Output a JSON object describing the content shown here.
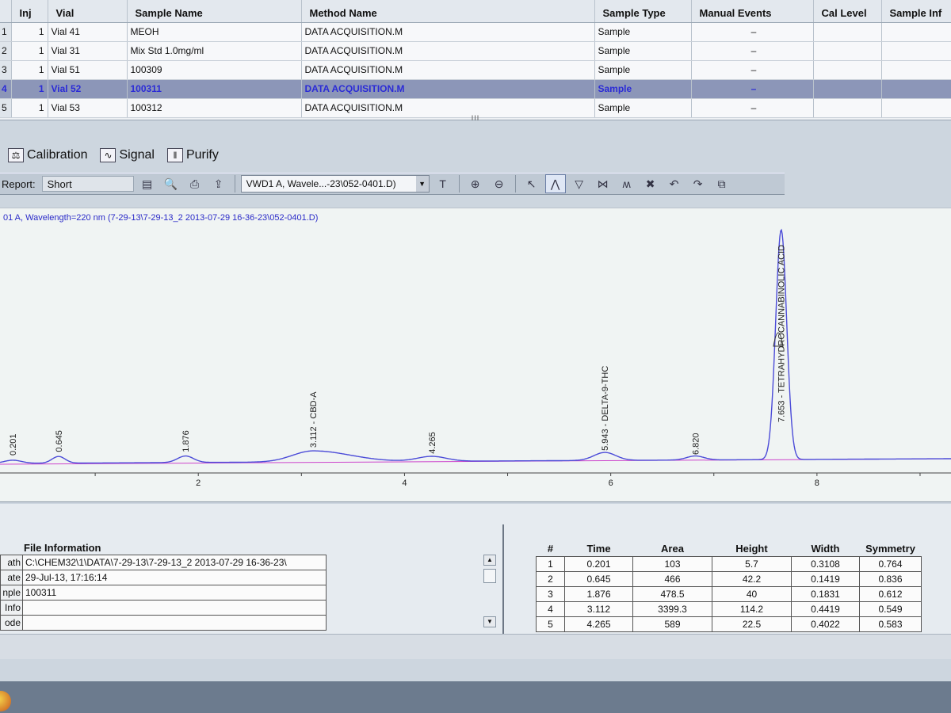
{
  "sequence": {
    "columns": [
      "Inj",
      "Vial",
      "Sample Name",
      "Method Name",
      "Sample Type",
      "Manual Events",
      "Cal Level",
      "Sample Inf"
    ],
    "rows": [
      {
        "row": "1",
        "inj": "1",
        "vial": "Vial 41",
        "sample": "MEOH",
        "method": "DATA ACQUISITION.M",
        "type": "Sample",
        "manual": "–",
        "cal": "",
        "info": ""
      },
      {
        "row": "2",
        "inj": "1",
        "vial": "Vial 31",
        "sample": "Mix Std 1.0mg/ml",
        "method": "DATA ACQUISITION.M",
        "type": "Sample",
        "manual": "–",
        "cal": "",
        "info": ""
      },
      {
        "row": "3",
        "inj": "1",
        "vial": "Vial 51",
        "sample": "100309",
        "method": "DATA ACQUISITION.M",
        "type": "Sample",
        "manual": "–",
        "cal": "",
        "info": ""
      },
      {
        "row": "4",
        "inj": "1",
        "vial": "Vial 52",
        "sample": "100311",
        "method": "DATA ACQUISITION.M",
        "type": "Sample",
        "manual": "–",
        "cal": "",
        "info": ""
      },
      {
        "row": "5",
        "inj": "1",
        "vial": "Vial 53",
        "sample": "100312",
        "method": "DATA ACQUISITION.M",
        "type": "Sample",
        "manual": "–",
        "cal": "",
        "info": ""
      }
    ],
    "selected_row": 3,
    "splitter": "III"
  },
  "tabs": {
    "calibration": "Calibration",
    "signal": "Signal",
    "purify": "Purify"
  },
  "toolbar": {
    "report_label": "Report:",
    "report_value": "Short",
    "signal_value": "VWD1 A, Wavele...-23\\052-0401.D)",
    "icons": [
      "page-setup-icon",
      "print-preview-icon",
      "print-icon",
      "export-icon",
      "method-icon",
      "zoom-in-icon",
      "zoom-out-icon",
      "pointer-icon",
      "peak-icon",
      "valley-icon",
      "split-peak-icon",
      "multi-peak-icon",
      "delete-peak-icon",
      "undo-icon",
      "redo-icon",
      "copy-icon"
    ]
  },
  "chromatogram": {
    "signal_title": "01 A, Wavelength=220 nm (7-29-13\\7-29-13_2 2013-07-29 16-36-23\\052-0401.D)",
    "line_color": "#4b4bd8",
    "baseline_color": "#cc44cc"
  },
  "chart_data": {
    "type": "line",
    "title": "",
    "xlabel": "",
    "ylabel": "",
    "x_ticks": [
      2,
      4,
      6,
      8
    ],
    "xlim": [
      0,
      9.3
    ],
    "peaks": [
      {
        "rt": 0.201,
        "label": "0.201",
        "height": 5.7
      },
      {
        "rt": 0.645,
        "label": "0.645",
        "height": 42.2
      },
      {
        "rt": 1.876,
        "label": "1.876",
        "height": 40
      },
      {
        "rt": 3.112,
        "label": "3.112 - CBD-A",
        "height": 114.2
      },
      {
        "rt": 4.265,
        "label": "4.265",
        "height": 22.5
      },
      {
        "rt": 5.943,
        "label": "5.943 - DELTA-9-THC",
        "height": 60
      },
      {
        "rt": 6.82,
        "label": "6.820",
        "height": 15
      },
      {
        "rt": 7.653,
        "label": "7.653 - TETRAHYDROCANNABINOLIC ACID",
        "height": 2000
      }
    ]
  },
  "file_info": {
    "title": "File Information",
    "rows": [
      {
        "k": "ath",
        "v": "C:\\CHEM32\\1\\DATA\\7-29-13\\7-29-13_2 2013-07-29 16-36-23\\"
      },
      {
        "k": "ate",
        "v": "29-Jul-13, 17:16:14"
      },
      {
        "k": "nple",
        "v": "100311"
      },
      {
        "k": "Info",
        "v": ""
      },
      {
        "k": "ode",
        "v": ""
      }
    ]
  },
  "peak_table": {
    "columns": [
      "#",
      "Time",
      "Area",
      "Height",
      "Width",
      "Symmetry"
    ],
    "rows": [
      [
        "1",
        "0.201",
        "103",
        "5.7",
        "0.3108",
        "0.764"
      ],
      [
        "2",
        "0.645",
        "466",
        "42.2",
        "0.1419",
        "0.836"
      ],
      [
        "3",
        "1.876",
        "478.5",
        "40",
        "0.1831",
        "0.612"
      ],
      [
        "4",
        "3.112",
        "3399.3",
        "114.2",
        "0.4419",
        "0.549"
      ],
      [
        "5",
        "4.265",
        "589",
        "22.5",
        "0.4022",
        "0.583"
      ]
    ]
  }
}
